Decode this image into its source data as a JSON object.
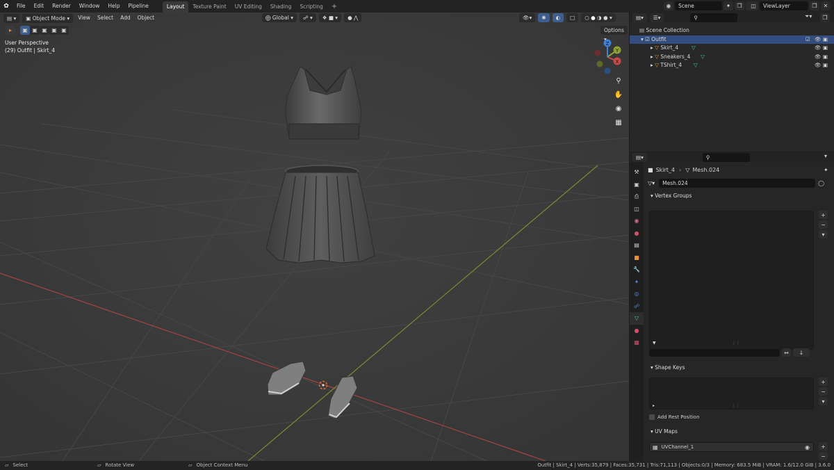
{
  "topbar": {
    "menus": [
      "File",
      "Edit",
      "Render",
      "Window",
      "Help",
      "Pipeline"
    ],
    "workspaces": [
      "Layout",
      "Texture Paint",
      "UV Editing",
      "Shading",
      "Scripting"
    ],
    "active_workspace": "Layout",
    "add_tab": "+",
    "scene": "Scene",
    "view_layer": "ViewLayer"
  },
  "viewport": {
    "mode": "Object Mode",
    "menus": [
      "View",
      "Select",
      "Add",
      "Object"
    ],
    "transform_orientation": "Global",
    "options_label": "Options",
    "info_line1": "User Perspective",
    "info_line2": "(29) Outfit | Skirt_4",
    "gizmo": {
      "x": "X",
      "y": "Y",
      "z": "Z"
    }
  },
  "outliner": {
    "root": "Scene Collection",
    "collection": "Outfit",
    "objects": [
      "Skirt_4",
      "Sneakers_4",
      "TShirt_4"
    ]
  },
  "properties": {
    "breadcrumb_object": "Skirt_4",
    "breadcrumb_mesh": "Mesh.024",
    "mesh_name": "Mesh.024",
    "panels": {
      "vertex_groups": "Vertex Groups",
      "shape_keys": "Shape Keys",
      "add_rest_position": "Add Rest Position",
      "uv_maps": "UV Maps",
      "uv_channel": "UVChannel_1"
    }
  },
  "statusbar": {
    "select": "Select",
    "rotate": "Rotate View",
    "context_menu": "Object Context Menu",
    "stats": "Outfit | Skirt_4 | Verts:35,879 | Faces:35,731 | Tris:71,113 | Objects:0/3 | Memory: 683.5 MiB | VRAM: 1.6/12.0 GiB | 3.6.0"
  },
  "colors": {
    "accent": "#334d80",
    "x_axis": "#c84a4a",
    "y_axis": "#8ea03a",
    "z_axis": "#3f7fd6",
    "mesh_icon": "#49c98d",
    "object_icon": "#e8913a"
  }
}
